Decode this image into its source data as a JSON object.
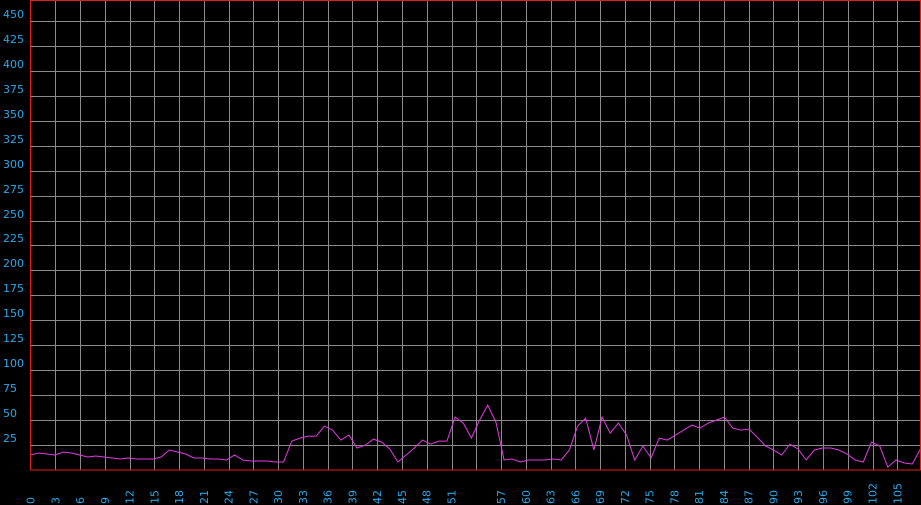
{
  "chart_data": {
    "type": "line",
    "title": "",
    "xlabel": "",
    "ylabel": "",
    "xlim": [
      0,
      107
    ],
    "ylim": [
      0,
      470
    ],
    "grid": true,
    "colors": {
      "background": "#000000",
      "grid": "#8a8a8a",
      "frame": "#e0201c",
      "baseline": "#22d021",
      "series": "#e23be2",
      "tick_text": "#29a8ea"
    },
    "y_ticks": [
      25,
      50,
      75,
      100,
      125,
      150,
      175,
      200,
      225,
      250,
      275,
      300,
      325,
      350,
      375,
      400,
      425,
      450
    ],
    "x_ticks": [
      0,
      3,
      6,
      9,
      12,
      15,
      18,
      21,
      24,
      27,
      30,
      33,
      36,
      39,
      42,
      45,
      48,
      51,
      54,
      57,
      60,
      63,
      66,
      69,
      72,
      75,
      78,
      81,
      84,
      87,
      90,
      93,
      96,
      99,
      102,
      105
    ],
    "x_tick_labels": [
      "0",
      "3",
      "6",
      "9",
      "12",
      "15",
      "18",
      "21",
      "24",
      "27",
      "30",
      "33",
      "36",
      "39",
      "42",
      "45",
      "48",
      "51",
      "",
      "57",
      "60",
      "63",
      "66",
      "69",
      "72",
      "75",
      "78",
      "81",
      "84",
      "87",
      "90",
      "93",
      "96",
      "99",
      "102",
      "105"
    ],
    "series": [
      {
        "values": [
          15,
          17,
          16,
          15,
          18,
          17,
          15,
          13,
          14,
          13,
          12,
          11,
          12,
          11,
          11,
          11,
          13,
          20,
          18,
          16,
          12,
          12,
          11,
          11,
          10,
          15,
          10,
          9,
          9,
          9,
          8,
          8,
          29,
          32,
          34,
          34,
          44,
          40,
          30,
          35,
          22,
          25,
          31,
          28,
          21,
          8,
          15,
          22,
          30,
          26,
          29,
          29,
          53,
          47,
          32,
          50,
          65,
          48,
          10,
          11,
          8,
          10,
          10,
          10,
          11,
          10,
          20,
          44,
          52,
          20,
          53,
          37,
          47,
          35,
          10,
          24,
          12,
          32,
          30,
          35,
          40,
          45,
          42,
          47,
          50,
          53,
          42,
          40,
          41,
          33,
          24,
          20,
          15,
          26,
          21,
          10,
          20,
          22,
          22,
          20,
          16,
          10,
          8,
          28,
          24,
          3,
          10,
          7,
          6,
          21
        ]
      }
    ]
  }
}
